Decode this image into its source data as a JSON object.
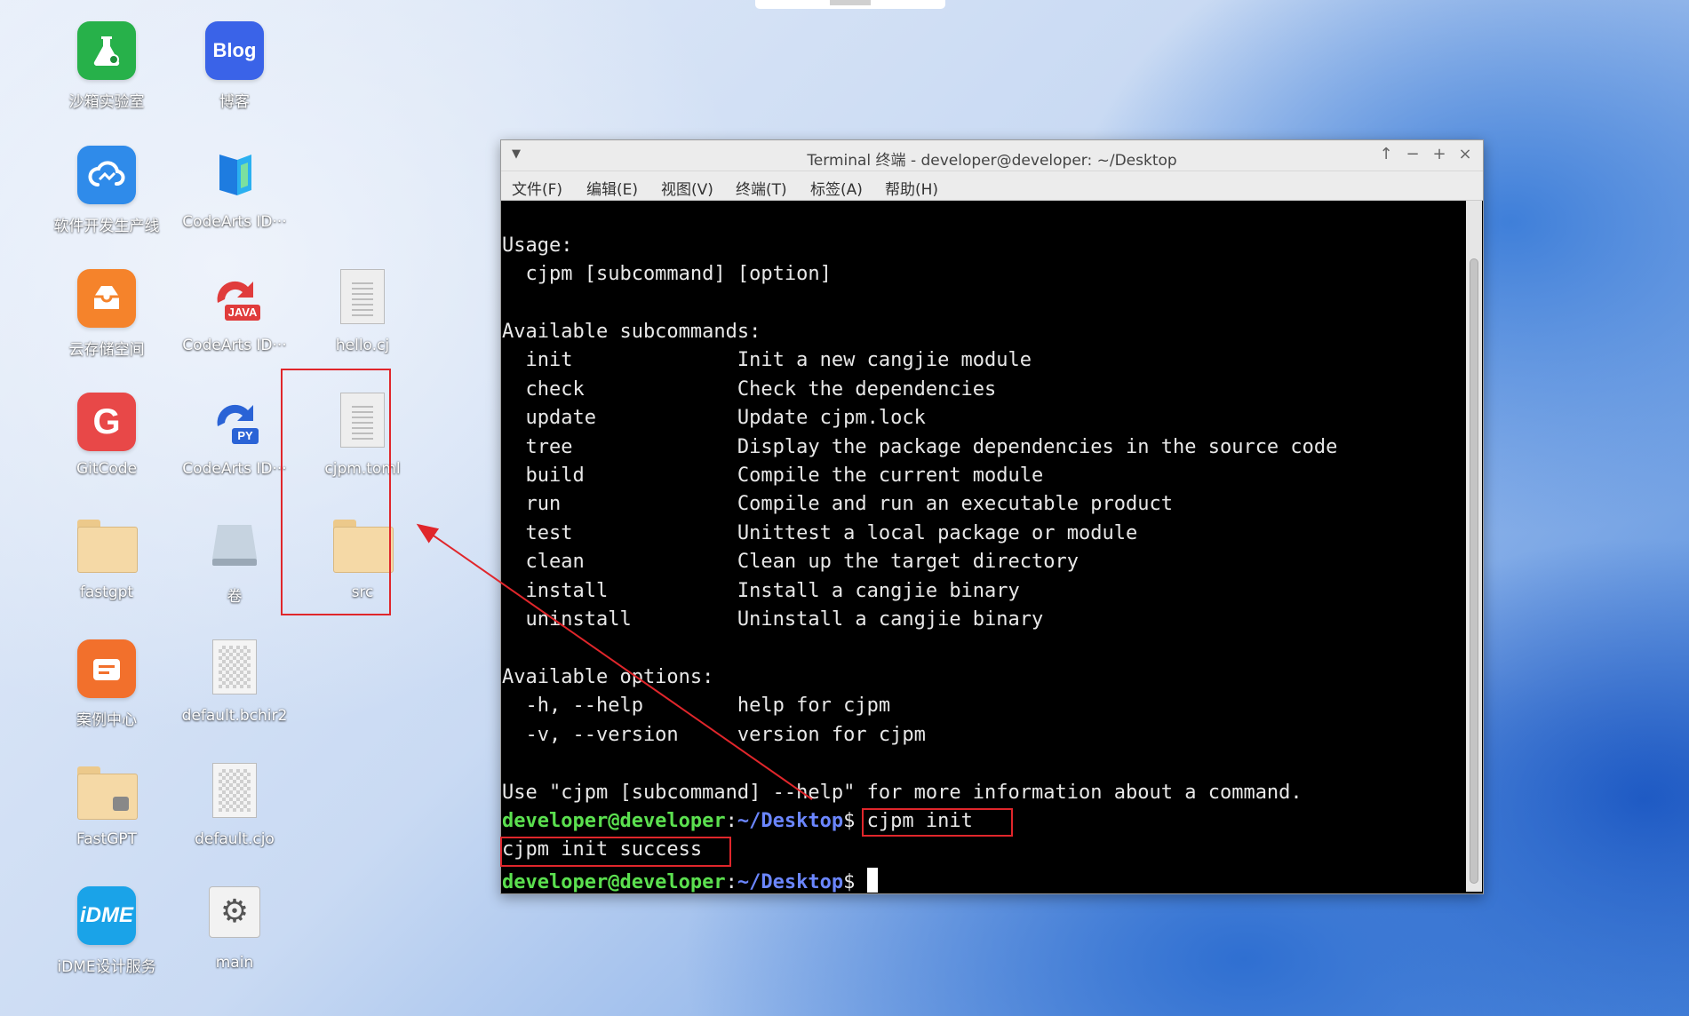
{
  "desktop": {
    "icons": [
      {
        "label": "沙箱实验室",
        "icon": "flask-app-icon",
        "color": "#27b14a"
      },
      {
        "label": "博客",
        "icon": "blog-app-icon",
        "color": "#3a63e8",
        "glyph": "Blog"
      },
      {
        "label": "软件开发生产线",
        "icon": "cloud-devops-icon",
        "color": "#2f8bea"
      },
      {
        "label": "CodeArts ID···",
        "icon": "codearts-ide-icon",
        "color": "#1e7ce0"
      },
      {
        "label": "云存储空间",
        "icon": "cloud-storage-icon",
        "color": "#f5832b"
      },
      {
        "label": "CodeArts ID···",
        "icon": "codearts-java-icon",
        "badge": "JAVA",
        "color": "#e03c3c"
      },
      {
        "label": "hello.cj",
        "icon": "text-file-icon"
      },
      {
        "label": "GitCode",
        "icon": "gitcode-icon",
        "color": "#e84848",
        "glyph": "G"
      },
      {
        "label": "CodeArts ID···",
        "icon": "codearts-python-icon",
        "badge": "PY",
        "color": "#2a63d6"
      },
      {
        "label": "cjpm.toml",
        "icon": "text-file-icon"
      },
      {
        "label": "fastgpt",
        "icon": "folder-icon"
      },
      {
        "label": "卷",
        "icon": "drive-icon"
      },
      {
        "label": "src",
        "icon": "folder-icon"
      },
      {
        "label": "案例中心",
        "icon": "case-center-icon",
        "color": "#f2702c"
      },
      {
        "label": "default.bchir2",
        "icon": "binary-file-icon"
      },
      {
        "label": "FastGPT",
        "icon": "locked-folder-icon"
      },
      {
        "label": "default.cjo",
        "icon": "binary-file-icon"
      },
      {
        "label": "iDME设计服务",
        "icon": "idme-icon",
        "color": "#1aa3e8",
        "glyph": "iDME"
      },
      {
        "label": "main",
        "icon": "gear-exec-icon"
      }
    ]
  },
  "terminal": {
    "title": "Terminal 终端 - developer@developer: ~/Desktop",
    "window_controls": {
      "up": "↑",
      "minimize": "−",
      "maximize": "+",
      "close": "×"
    },
    "menu": [
      "文件(F)",
      "编辑(E)",
      "视图(V)",
      "终端(T)",
      "标签(A)",
      "帮助(H)"
    ],
    "lines": [
      "Usage:",
      "  cjpm [subcommand] [option]",
      "",
      "Available subcommands:",
      "  init              Init a new cangjie module",
      "  check             Check the dependencies",
      "  update            Update cjpm.lock",
      "  tree              Display the package dependencies in the source code",
      "  build             Compile the current module",
      "  run               Compile and run an executable product",
      "  test              Unittest a local package or module",
      "  clean             Clean up the target directory",
      "  install           Install a cangjie binary",
      "  uninstall         Uninstall a cangjie binary",
      "",
      "Available options:",
      "  -h, --help        help for cjpm",
      "  -v, --version     version for cjpm",
      "",
      "Use \"cjpm [subcommand] --help\" for more information about a command."
    ],
    "prompt_user": "developer@developer",
    "prompt_sep": ":",
    "prompt_path": "~/Desktop",
    "prompt_dollar": "$",
    "command": " cjpm init",
    "output": "cjpm init success"
  },
  "colors": {
    "annotation": "#e0262b",
    "prompt_user": "#5be04f",
    "prompt_path": "#6b86ff"
  }
}
